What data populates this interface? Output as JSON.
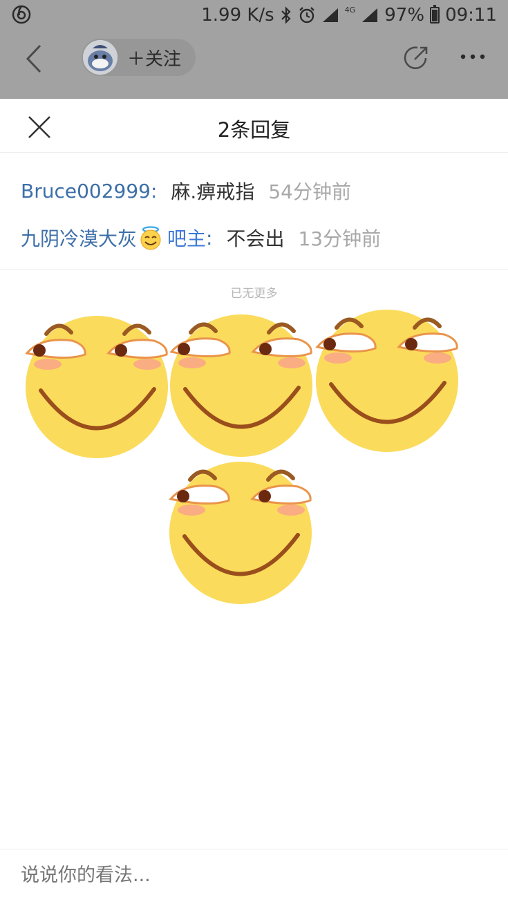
{
  "status_bar": {
    "net_speed": "1.99 K/s",
    "network": "4G",
    "battery": "97%",
    "time": "09:11",
    "icons": [
      "netease-music-icon",
      "bluetooth-icon",
      "alarm-icon",
      "signal-icon",
      "battery-icon"
    ]
  },
  "header": {
    "follow_label": "＋关注",
    "icons": [
      "back-icon",
      "share-icon",
      "more-icon"
    ]
  },
  "sheet": {
    "title": "2条回复",
    "close_icon": "close-icon"
  },
  "replies": [
    {
      "user": "Bruce002999",
      "badge": "",
      "content": "麻.痹戒指",
      "time": "54分钟前"
    },
    {
      "user": "九阴冷漠大灰",
      "badge": "吧主",
      "content": "不会出",
      "time": "13分钟前",
      "emoji": "halo-smile-emoji"
    }
  ],
  "no_more": "已无更多",
  "stickers": {
    "count": 4,
    "icon": "smirk-face-sticker"
  },
  "comment": {
    "placeholder": "说说你的看法..."
  },
  "colors": {
    "overlay": "#a2a2a2",
    "username": "#3d6fa8",
    "badge": "#3d78d8",
    "time": "#a8a8a8",
    "face": "#fbdb5c"
  }
}
